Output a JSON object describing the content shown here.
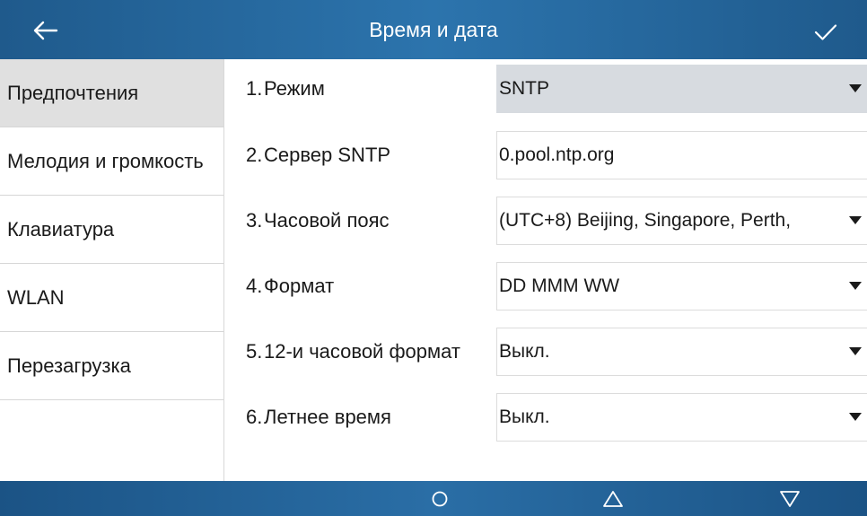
{
  "header": {
    "title": "Время и дата",
    "back_icon": "arrow-left-icon",
    "confirm_icon": "checkmark-icon"
  },
  "sidebar": {
    "items": [
      {
        "label": "Предпочтения",
        "active": true
      },
      {
        "label": "Мелодия и громкость",
        "active": false
      },
      {
        "label": "Клавиатура",
        "active": false
      },
      {
        "label": "WLAN",
        "active": false
      },
      {
        "label": "Перезагрузка",
        "active": false
      }
    ]
  },
  "settings": {
    "rows": [
      {
        "num": "1.",
        "label": "Режим",
        "value": "SNTP",
        "disabled": true
      },
      {
        "num": "2.",
        "label": "Сервер SNTP",
        "value": "0.pool.ntp.org",
        "type": "text"
      },
      {
        "num": "3.",
        "label": "Часовой пояс",
        "value": "(UTC+8) Beijing, Singapore, Perth,"
      },
      {
        "num": "4.",
        "label": "Формат",
        "value": "DD MMM WW"
      },
      {
        "num": "5.",
        "label": "12-и часовой формат",
        "value": "Выкл."
      },
      {
        "num": "6.",
        "label": "Летнее время",
        "value": "Выкл."
      }
    ]
  },
  "navbar": {
    "icons": [
      "circle-home-icon",
      "triangle-up-icon",
      "triangle-down-icon"
    ]
  },
  "colors": {
    "header_bg": "#2a6ea6",
    "sidebar_active_bg": "#e0e0e0",
    "disabled_field_bg": "#d7dbe0"
  }
}
